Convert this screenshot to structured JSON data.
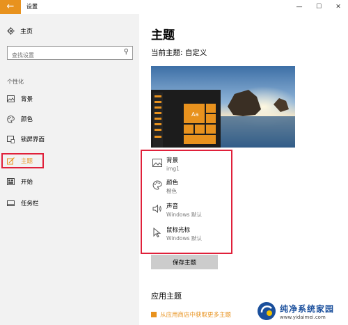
{
  "window": {
    "title": "设置",
    "back_icon": "back-arrow-icon",
    "minimize": "—",
    "maximize": "☐",
    "close": "✕"
  },
  "sidebar": {
    "home_label": "主页",
    "search_placeholder": "查找设置",
    "section_label": "个性化",
    "items": [
      {
        "label": "背景",
        "icon": "picture-icon",
        "active": false
      },
      {
        "label": "颜色",
        "icon": "palette-icon",
        "active": false
      },
      {
        "label": "锁屏界面",
        "icon": "lock-screen-icon",
        "active": false
      },
      {
        "label": "主题",
        "icon": "brush-icon",
        "active": true
      },
      {
        "label": "开始",
        "icon": "start-menu-icon",
        "active": false
      },
      {
        "label": "任务栏",
        "icon": "taskbar-icon",
        "active": false
      }
    ]
  },
  "main": {
    "page_title": "主题",
    "current_theme": "当前主题: 自定义",
    "preview": {
      "tile_label": "Aa",
      "accent_color": "#e8921e"
    },
    "settings": [
      {
        "name": "背景",
        "value": "img1",
        "icon": "picture-icon"
      },
      {
        "name": "颜色",
        "value": "橙色",
        "icon": "palette-icon"
      },
      {
        "name": "声音",
        "value": "Windows 默认",
        "icon": "speaker-icon"
      },
      {
        "name": "鼠标光标",
        "value": "Windows 默认",
        "icon": "cursor-icon"
      }
    ],
    "save_button": "保存主题",
    "apply_title": "应用主题",
    "store_link": "从应用商店中获取更多主题"
  },
  "watermark": {
    "main_text": "纯净系统家园",
    "url": "www.yidaimei.com"
  },
  "colors": {
    "accent": "#e8921e",
    "highlight_box": "#e0203a",
    "sidebar_bg": "#f2f2f2"
  }
}
